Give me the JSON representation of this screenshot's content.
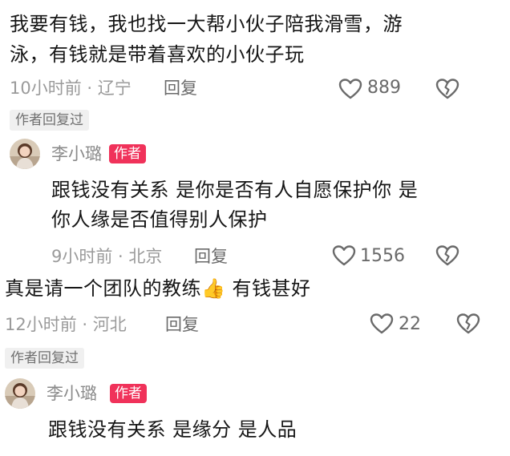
{
  "c1": {
    "line1": "我要有钱，我也找一大帮小伙子陪我滑雪，游",
    "line2": "泳，有钱就是带着喜欢的小伙子玩",
    "time": "10小时前 · 辽宁",
    "reply": "回复",
    "likes": "889",
    "tag": "作者回复过"
  },
  "r1": {
    "name": "李小璐",
    "badge": "作者",
    "line1": "跟钱没有关系 是你是否有人自愿保护你 是",
    "line2": "你人缘是否值得别人保护",
    "time": "9小时前 · 北京",
    "reply": "回复",
    "likes": "1556"
  },
  "c2": {
    "text_a": "真是请一个团队的教练",
    "emoji": "👍",
    "text_b": " 有钱甚好",
    "time": "12小时前 · 河北",
    "reply": "回复",
    "likes": "22",
    "tag": "作者回复过"
  },
  "r2": {
    "name": "李小璐",
    "badge": "作者",
    "line1": "跟钱没有关系 是缘分 是人品"
  }
}
